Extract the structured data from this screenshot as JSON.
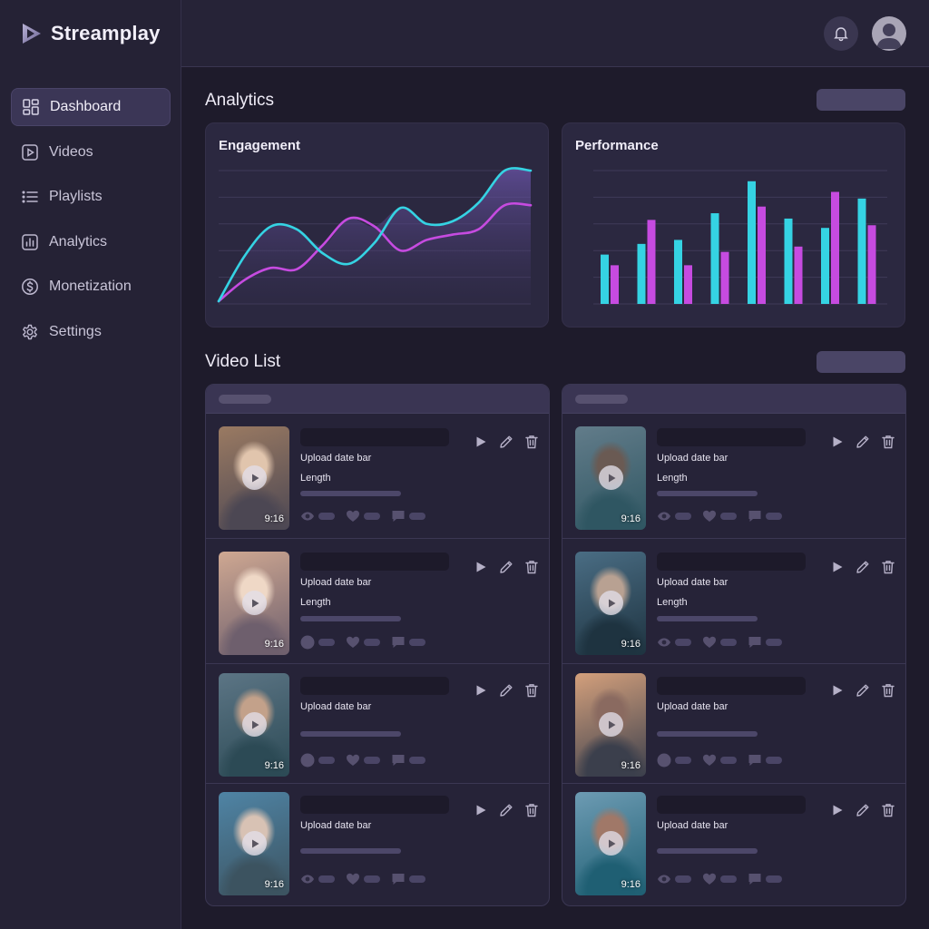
{
  "app": {
    "name": "Streamplay"
  },
  "sidebar": {
    "items": [
      {
        "label": "Dashboard",
        "icon": "dashboard-icon",
        "active": true
      },
      {
        "label": "Videos",
        "icon": "video-icon",
        "active": false
      },
      {
        "label": "Playlists",
        "icon": "playlist-icon",
        "active": false
      },
      {
        "label": "Analytics",
        "icon": "analytics-icon",
        "active": false
      },
      {
        "label": "Monetization",
        "icon": "dollar-icon",
        "active": false
      },
      {
        "label": "Settings",
        "icon": "gear-icon",
        "active": false
      }
    ]
  },
  "header": {
    "notification_icon": "bell-icon",
    "avatar_icon": "user-avatar-icon"
  },
  "analytics": {
    "title": "Analytics",
    "engagement_title": "Engagement",
    "performance_title": "Performance"
  },
  "video_list": {
    "title": "Video List",
    "upload_date_label": "Upload date bar",
    "length_label": "Length",
    "aspect_label": "9:16"
  },
  "colors": {
    "cyan": "#35d3e3",
    "magenta": "#c64be0",
    "background": "#1e1b2b",
    "sidebar": "#252235",
    "card": "#2b2840"
  },
  "chart_data": [
    {
      "type": "area",
      "title": "Engagement",
      "grid": true,
      "x": [
        0,
        1,
        2,
        3,
        4,
        5,
        6,
        7,
        8,
        9,
        10,
        11,
        12
      ],
      "ylim": [
        0,
        100
      ],
      "series": [
        {
          "color": "#35d3e3",
          "values": [
            2,
            36,
            58,
            56,
            38,
            30,
            46,
            72,
            60,
            62,
            76,
            100,
            100
          ]
        },
        {
          "color": "#c64be0",
          "values": [
            2,
            18,
            27,
            26,
            44,
            64,
            58,
            40,
            48,
            52,
            56,
            74,
            74
          ]
        }
      ]
    },
    {
      "type": "bar",
      "title": "Performance",
      "grid": true,
      "ylim": [
        0,
        100
      ],
      "categories": [
        "1",
        "2",
        "3",
        "4",
        "5",
        "6",
        "7",
        "8"
      ],
      "series": [
        {
          "color": "#35d3e3",
          "values": [
            37,
            45,
            48,
            68,
            92,
            64,
            57,
            79
          ]
        },
        {
          "color": "#c64be0",
          "values": [
            29,
            63,
            29,
            39,
            73,
            43,
            84,
            59
          ]
        }
      ]
    }
  ],
  "panels": [
    {
      "rows": [
        {
          "has_length": true,
          "stat_first_icon": "eye-icon"
        },
        {
          "has_length": true,
          "stat_first_icon": "circle-icon"
        },
        {
          "has_length": false,
          "stat_first_icon": "circle-icon"
        },
        {
          "has_length": false,
          "stat_first_icon": "eye-icon"
        }
      ]
    },
    {
      "rows": [
        {
          "has_length": true,
          "stat_first_icon": "eye-icon"
        },
        {
          "has_length": true,
          "stat_first_icon": "eye-icon"
        },
        {
          "has_length": false,
          "stat_first_icon": "circle-icon"
        },
        {
          "has_length": false,
          "stat_first_icon": "eye-icon"
        }
      ]
    }
  ]
}
